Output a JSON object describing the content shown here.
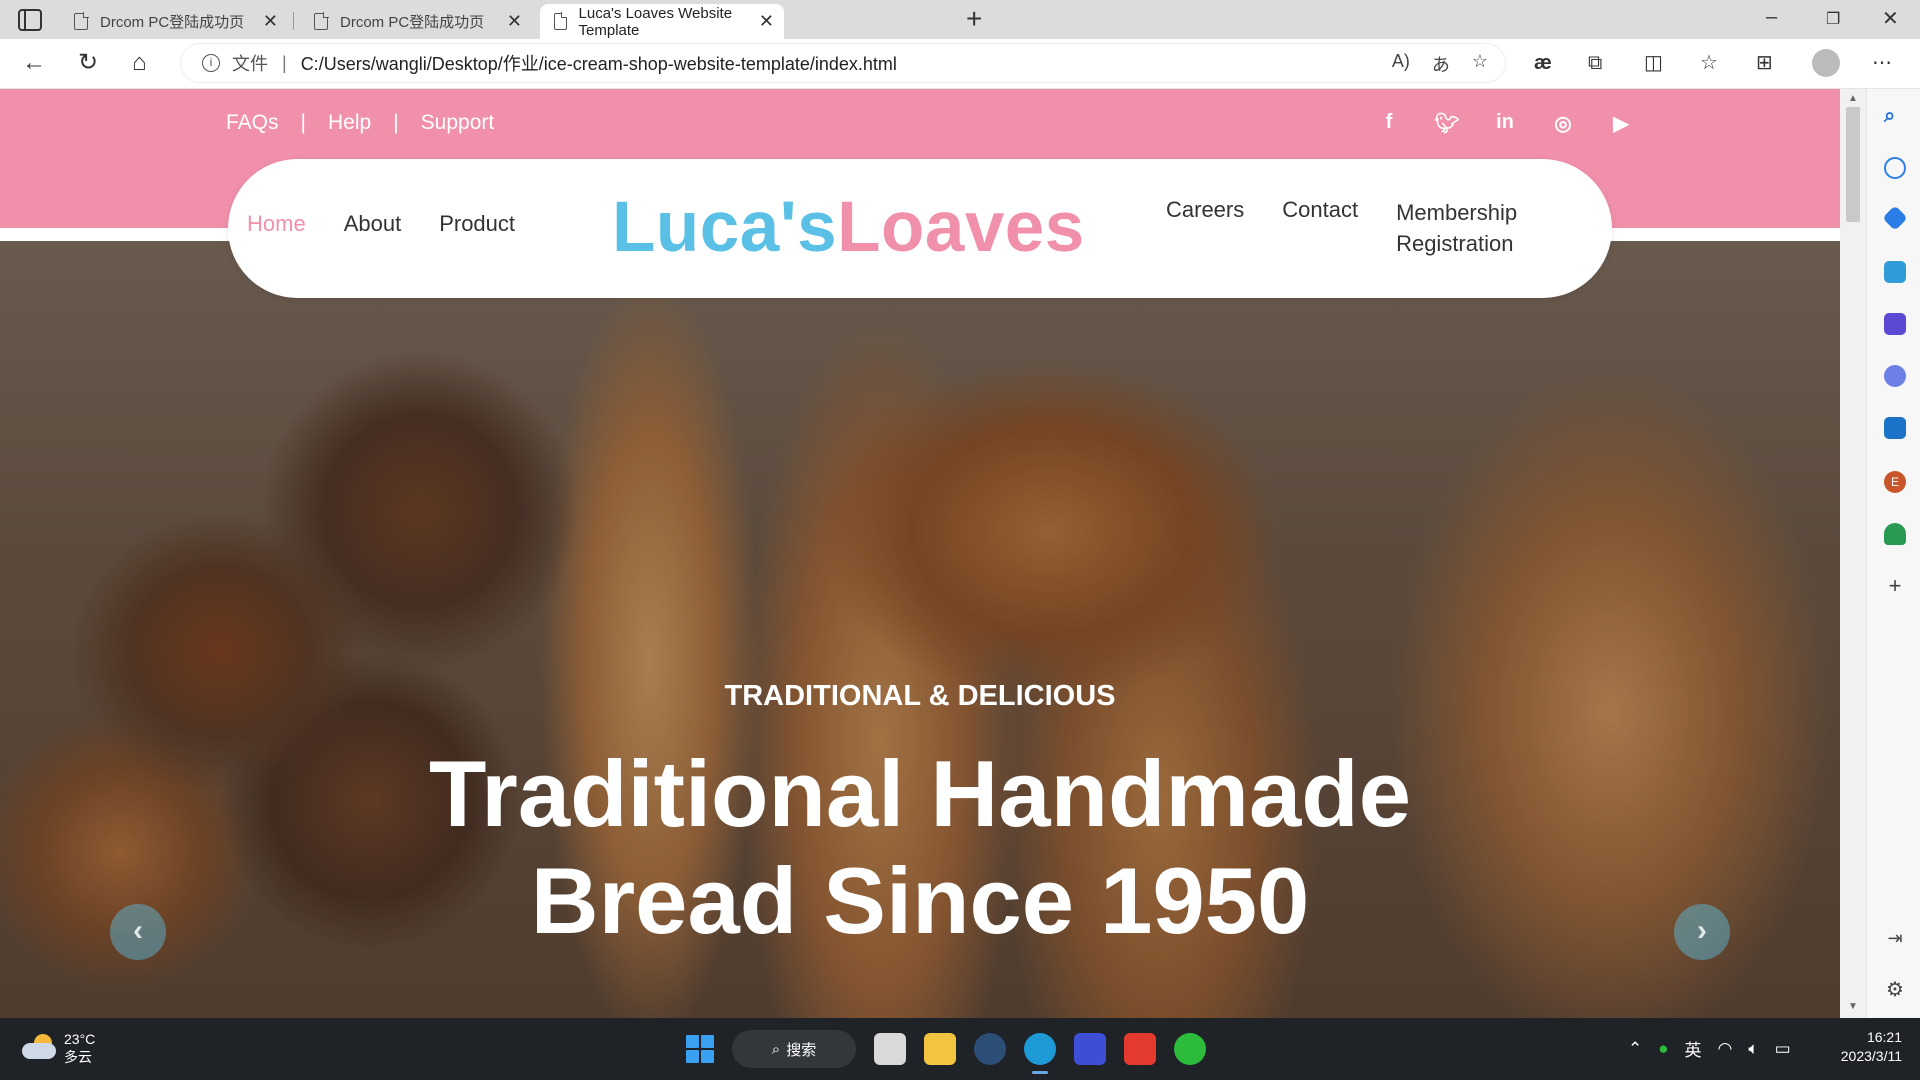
{
  "browser": {
    "tabs": [
      {
        "label": "Drcom PC登陆成功页",
        "active": false
      },
      {
        "label": "Drcom PC登陆成功页",
        "active": false
      },
      {
        "label": "Luca's Loaves Website Template",
        "active": true
      }
    ],
    "address": {
      "scheme_label": "文件",
      "url": "C:/Users/wangli/Desktop/作业/ice-cream-shop-website-template/index.html"
    }
  },
  "page": {
    "topbar": {
      "links": [
        "FAQs",
        "Help",
        "Support"
      ],
      "separator": "|",
      "socials": [
        "facebook-icon",
        "twitter-icon",
        "linkedin-icon",
        "instagram-icon",
        "youtube-icon"
      ]
    },
    "nav": {
      "left": [
        "Home",
        "About",
        "Product"
      ],
      "active": "Home",
      "logo_part1": "Luca's",
      "logo_part2": "Loaves",
      "right": [
        "Careers",
        "Contact"
      ],
      "membership_line1": "Membership",
      "membership_line2": "Registration"
    },
    "hero": {
      "subtitle": "TRADITIONAL & DELICIOUS",
      "title_line1": "Traditional Handmade",
      "title_line2": "Bread Since 1950",
      "prev_symbol": "‹",
      "next_symbol": "›"
    },
    "colors": {
      "pink": "#f090ab",
      "blue": "#5ac0e6"
    }
  },
  "taskbar": {
    "weather_temp": "23°C",
    "weather_desc": "多云",
    "search_label": "搜索",
    "ime": "英",
    "time": "16:21",
    "date": "2023/3/11"
  }
}
